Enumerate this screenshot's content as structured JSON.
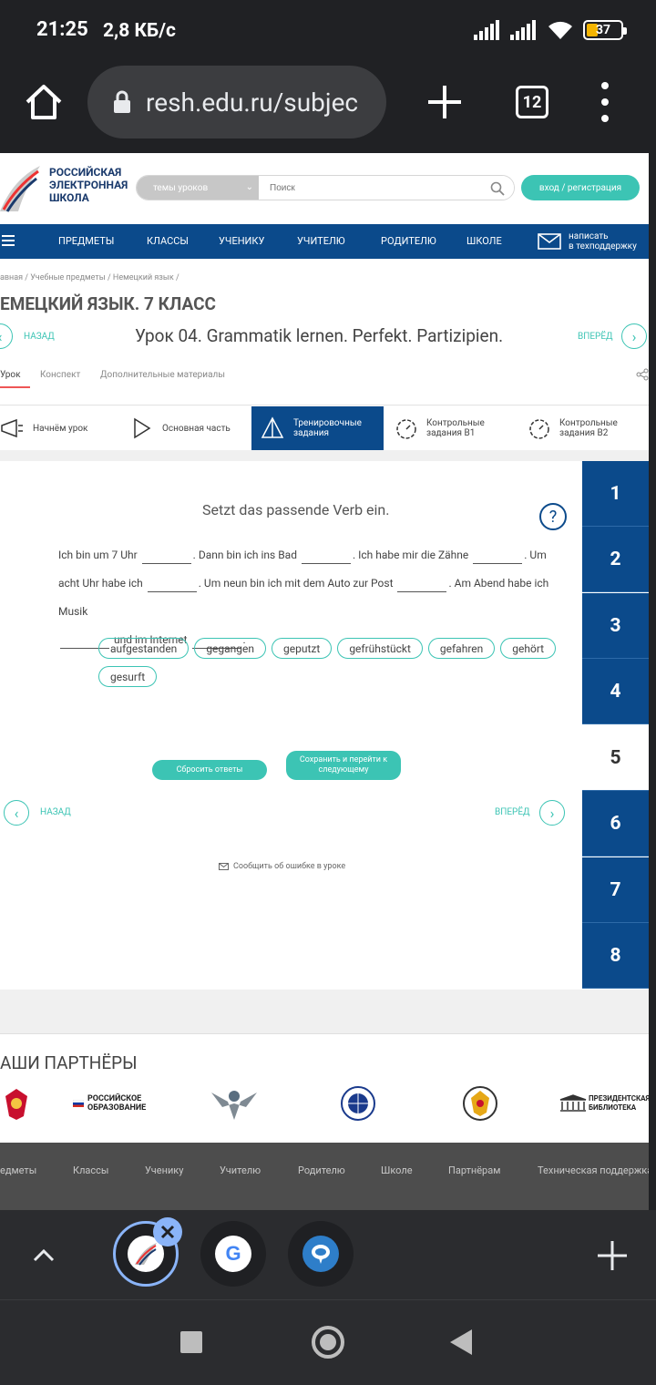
{
  "status": {
    "time": "21:25",
    "speed": "2,8 КБ/с",
    "battery": "37"
  },
  "browser": {
    "url": "resh.edu.ru/subjec",
    "tab_count": "12"
  },
  "site": {
    "logo_text": [
      "РОССИЙСКАЯ",
      "ЭЛЕКТРОННАЯ",
      "ШКОЛА"
    ],
    "topics_select": "темы уроков",
    "search_placeholder": "Поиск",
    "login_label": "вход / регистрация",
    "nav": [
      "ПРЕДМЕТЫ",
      "КЛАССЫ",
      "УЧЕНИКУ",
      "УЧИТЕЛЮ",
      "РОДИТЕЛЮ",
      "ШКОЛЕ"
    ],
    "support": [
      "написать",
      "в техподдержку"
    ]
  },
  "breadcrumb": "авная  /  Учебные предметы  /  Немецкий язык  /",
  "page_title": "ЕМЕЦКИЙ ЯЗЫК. 7 КЛАСС",
  "lesson": {
    "back": "НАЗАД",
    "forward": "ВПЕРЁД",
    "title": "Урок 04. Grammatik lernen. Perfekt. Partizipien."
  },
  "subtabs": [
    "Урок",
    "Конспект",
    "Дополнительные материалы"
  ],
  "steps": [
    {
      "label": "Начнём урок"
    },
    {
      "label": "Основная часть"
    },
    {
      "label": "Тренировочные задания"
    },
    {
      "label": "Контрольные задания В1"
    },
    {
      "label": "Контрольные задания В2"
    }
  ],
  "task": {
    "heading": "Setzt das passende Verb ein.",
    "help": "?",
    "parts": [
      "Ich bin um 7 Uhr",
      ". Dann bin ich ins Bad",
      ". Ich habe mir die Zähne",
      ". Um acht Uhr habe ich",
      ". Um neun bin ich mit dem Auto zur Post",
      ". Am Abend habe ich Musik",
      "und im Internet",
      "."
    ],
    "options": [
      "aufgestanden",
      "gegangen",
      "geputzt",
      "gefrühstückt",
      "gefahren",
      "gehört",
      "gesurft"
    ],
    "reset_label": "Сбросить ответы",
    "save_label": "Сохранить и перейти к следующему",
    "back": "НАЗАД",
    "forward": "ВПЕРЁД",
    "report": "Сообщить об ошибке в уроке"
  },
  "task_numbers": [
    "1",
    "2",
    "3",
    "4",
    "5",
    "6",
    "7",
    "8"
  ],
  "current_task": "5",
  "partners": {
    "title": "АШИ ПАРТНЁРЫ",
    "ros_obr": [
      "РОССИЙСКОЕ",
      "ОБРАЗОВАНИЕ"
    ],
    "library": [
      "ПРЕЗИДЕНТСКАЯ",
      "БИБЛИОТЕКА"
    ]
  },
  "footer": [
    "едметы",
    "Классы",
    "Ученику",
    "Учителю",
    "Родителю",
    "Школе",
    "Партнёрам",
    "Техническая поддержка"
  ],
  "colors": {
    "primary": "#0b4a8b",
    "accent": "#3cc4b4"
  }
}
